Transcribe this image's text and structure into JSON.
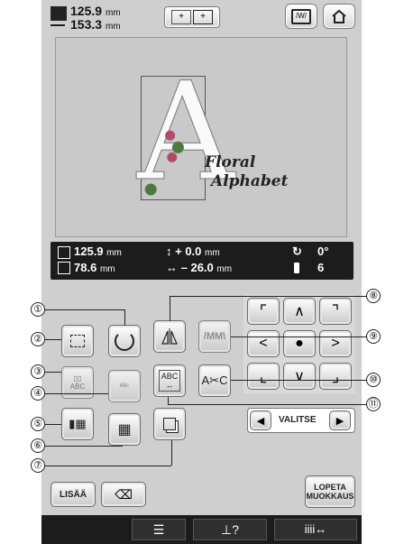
{
  "header": {
    "width_value": "125.9",
    "height_value": "153.3",
    "unit": "mm"
  },
  "preview": {
    "letter": "A",
    "caption_line1": "Floral",
    "caption_line2": "Alphabet"
  },
  "status": {
    "height_value": "125.9",
    "width_value": "78.6",
    "vertical_offset": "+  0.0",
    "horizontal_offset": "–  26.0",
    "unit": "mm",
    "rotation": "0°",
    "color_count": "6"
  },
  "buttons": {
    "lisaa": "LISÄÄ",
    "valitse": "VALITSE",
    "lopeta_line1": "LOPETA",
    "lopeta_line2": "MUOKKAUS"
  },
  "callouts": {
    "c1": "①",
    "c2": "②",
    "c3": "③",
    "c4": "④",
    "c5": "⑤",
    "c6": "⑥",
    "c7": "⑦",
    "c8": "⑧",
    "c9": "⑨",
    "c10": "⑩",
    "c11": "⑪"
  },
  "icons": {
    "size": "size-icon",
    "rotate": "rotate-icon",
    "mirror": "mirror-icon",
    "density": "density-icon",
    "arrow": "arrow-icon",
    "home": "home-icon"
  },
  "colors": {
    "frame": "#cfcfcf",
    "dark_bar": "#1c1c1c",
    "preview_bg": "#c9c9c9"
  }
}
